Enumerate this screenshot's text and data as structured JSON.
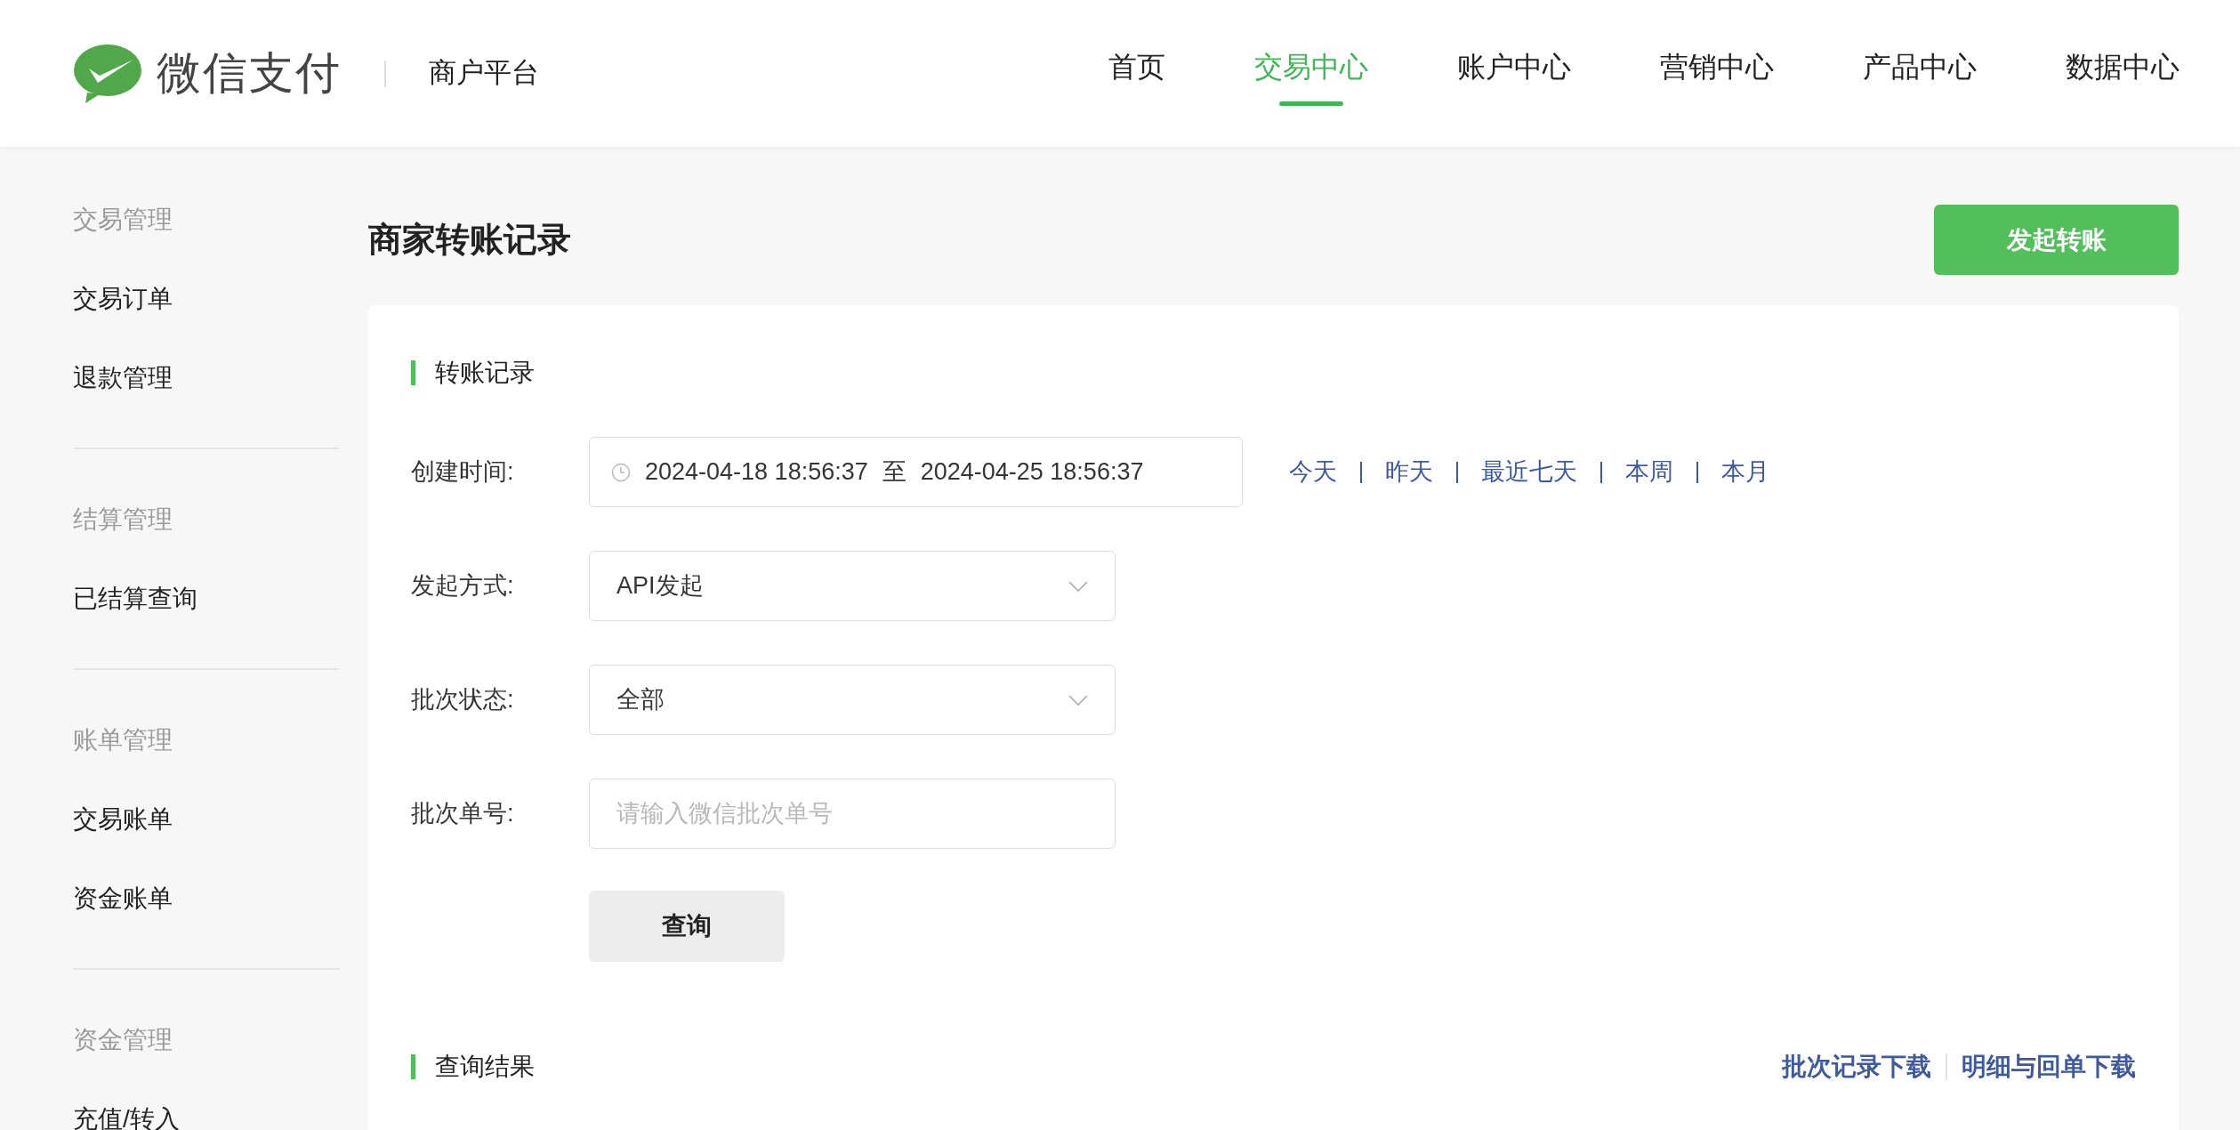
{
  "header": {
    "logo_text": "微信支付",
    "platform": "商户平台",
    "nav": [
      {
        "label": "首页",
        "selected": false
      },
      {
        "label": "交易中心",
        "selected": true
      },
      {
        "label": "账户中心",
        "selected": false
      },
      {
        "label": "营销中心",
        "selected": false
      },
      {
        "label": "产品中心",
        "selected": false
      },
      {
        "label": "数据中心",
        "selected": false
      }
    ]
  },
  "sidebar": {
    "groups": [
      {
        "title": "交易管理",
        "items": [
          "交易订单",
          "退款管理"
        ]
      },
      {
        "title": "结算管理",
        "items": [
          "已结算查询"
        ]
      },
      {
        "title": "账单管理",
        "items": [
          "交易账单",
          "资金账单"
        ]
      },
      {
        "title": "资金管理",
        "items": [
          "充值/转入"
        ]
      }
    ]
  },
  "page": {
    "title": "商家转账记录",
    "primary_button": "发起转账"
  },
  "filters": {
    "title": "转账记录",
    "fields": [
      {
        "kind": "daterange",
        "label": "创建时间:",
        "start": "2024-04-18 18:56:37",
        "separator": "至",
        "end": "2024-04-25 18:56:37",
        "shortcuts": [
          "今天",
          "昨天",
          "最近七天",
          "本周",
          "本月"
        ]
      },
      {
        "kind": "select",
        "label": "发起方式:",
        "value": "API发起"
      },
      {
        "kind": "select",
        "label": "批次状态:",
        "value": "全部"
      },
      {
        "kind": "input",
        "label": "批次单号:",
        "placeholder": "请输入微信批次单号"
      }
    ],
    "query_button": "查询"
  },
  "results": {
    "title": "查询结果",
    "links": [
      "批次记录下载",
      "明细与回单下载"
    ]
  }
}
